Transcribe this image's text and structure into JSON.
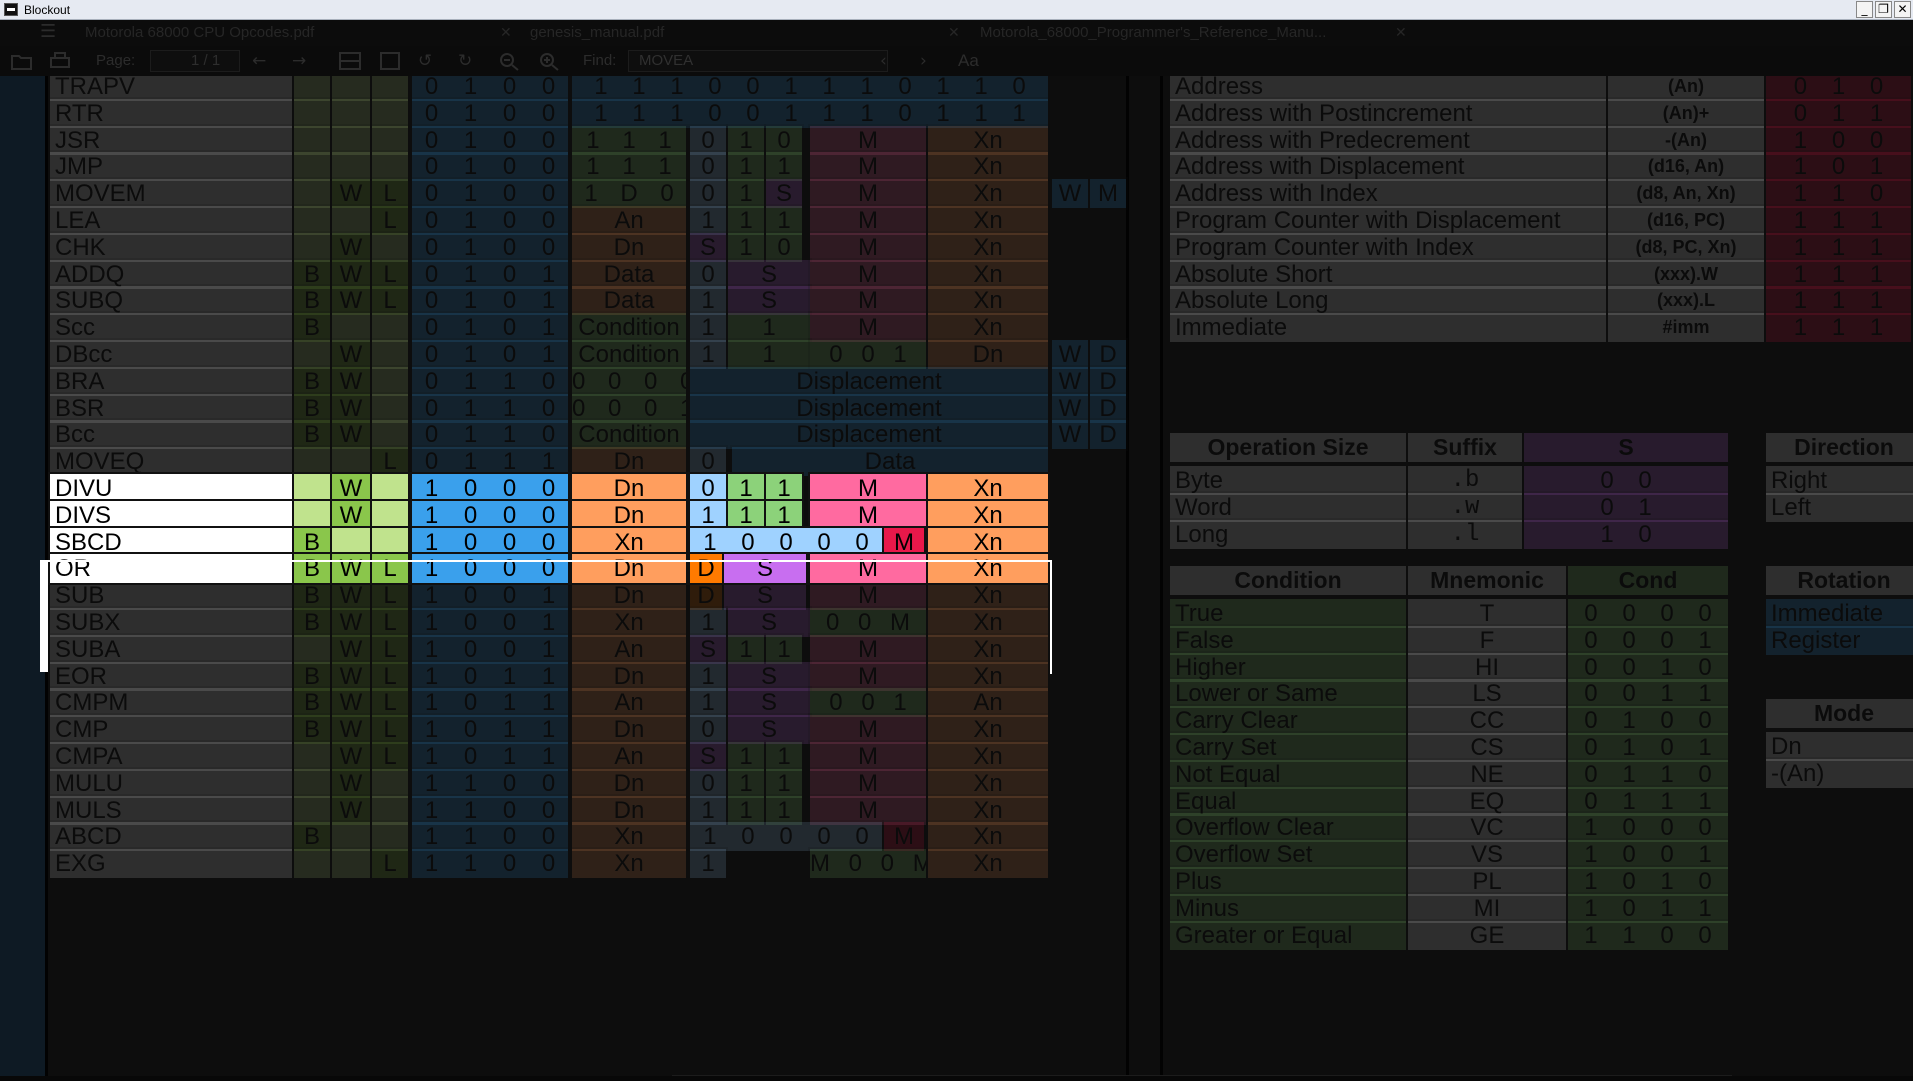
{
  "window": {
    "title": "Blockout",
    "minimize_glyph": "_",
    "restore_glyph": "❐",
    "close_glyph": "✕"
  },
  "tabs": [
    {
      "label": "Motorola 68000 CPU Opcodes.pdf",
      "close": "✕"
    },
    {
      "label": "genesis_manual.pdf",
      "close": "✕"
    },
    {
      "label": "Motorola_68000_Programmer's_Reference_Manu...",
      "close": "✕"
    }
  ],
  "toolbar": {
    "page_label": "Page:",
    "page_value": "1",
    "page_total": "/ 1",
    "find_label": "Find:",
    "find_value": "MOVEA",
    "match_case_glyph": "Aa",
    "icons": [
      "open-icon",
      "print-icon",
      "prev-page-icon",
      "next-page-icon",
      "fit-width-icon",
      "fit-page-icon",
      "rotate-left-icon",
      "rotate-right-icon",
      "zoom-out-icon",
      "zoom-in-icon",
      "find-prev-icon",
      "find-next-icon",
      "match-case-icon"
    ]
  },
  "colors": {
    "highlight_name_bg": "#ffffff",
    "size_bg": "#c0e38d",
    "size_bg_green": "#8ac64b",
    "opcode_bg": "#3aa0ec",
    "register_bg": "#ff9e5e",
    "mode_bg": "#ff6aa0",
    "bit_light_blue": "#9fd2ff",
    "bit_green": "#8cd27a",
    "size_purple": "#c86ef0",
    "m_red": "#e8184a",
    "d_orange": "#ff7a00",
    "dim_overlay": "rgba(0,0,0,0.86)"
  },
  "opcodes": [
    {
      "name": "TRAPV",
      "b": "",
      "w": "",
      "l": "",
      "op": [
        "0",
        "1",
        "0",
        "0"
      ],
      "rest": "1 1 1 0 0 1 1 1 0 1 1 0"
    },
    {
      "name": "RTR",
      "b": "",
      "w": "",
      "l": "",
      "op": [
        "0",
        "1",
        "0",
        "0"
      ],
      "rest": "1 1 1 0 0 1 1 1 0 1 1 1"
    },
    {
      "name": "JSR",
      "b": "",
      "w": "",
      "l": "",
      "op": [
        "0",
        "1",
        "0",
        "0"
      ],
      "a": "1 1 1",
      "c": "0 1 0",
      "m": "M",
      "xn": "Xn"
    },
    {
      "name": "JMP",
      "b": "",
      "w": "",
      "l": "",
      "op": [
        "0",
        "1",
        "0",
        "0"
      ],
      "a": "1 1 1",
      "c": "0 1 1",
      "m": "M",
      "xn": "Xn"
    },
    {
      "name": "MOVEM",
      "b": "",
      "w": "W",
      "l": "L",
      "op": [
        "0",
        "1",
        "0",
        "0"
      ],
      "a": "1 D 0",
      "c": "0 1 S",
      "m": "M",
      "xn": "Xn",
      "ext": [
        "W",
        "M"
      ]
    },
    {
      "name": "LEA",
      "b": "",
      "w": "",
      "l": "L",
      "op": [
        "0",
        "1",
        "0",
        "0"
      ],
      "a": "An",
      "c": "1 1 1",
      "m": "M",
      "xn": "Xn"
    },
    {
      "name": "CHK",
      "b": "",
      "w": "W",
      "l": "",
      "op": [
        "0",
        "1",
        "0",
        "0"
      ],
      "a": "Dn",
      "c": "S 1 0",
      "m": "M",
      "xn": "Xn"
    },
    {
      "name": "ADDQ",
      "b": "B",
      "w": "W",
      "l": "L",
      "op": [
        "0",
        "1",
        "0",
        "1"
      ],
      "a": "Data",
      "c": "0 S",
      "m": "M",
      "xn": "Xn"
    },
    {
      "name": "SUBQ",
      "b": "B",
      "w": "W",
      "l": "L",
      "op": [
        "0",
        "1",
        "0",
        "1"
      ],
      "a": "Data",
      "c": "1 S",
      "m": "M",
      "xn": "Xn"
    },
    {
      "name": "Scc",
      "b": "B",
      "w": "",
      "l": "",
      "op": [
        "0",
        "1",
        "0",
        "1"
      ],
      "a": "Condition",
      "c": "1 1",
      "m": "M",
      "xn": "Xn"
    },
    {
      "name": "DBcc",
      "b": "",
      "w": "W",
      "l": "",
      "op": [
        "0",
        "1",
        "0",
        "1"
      ],
      "a": "Condition",
      "c": "1 1",
      "m": "0 0 1",
      "xn": "Dn",
      "ext": [
        "W",
        "D"
      ]
    },
    {
      "name": "BRA",
      "b": "B",
      "w": "W",
      "l": "",
      "op": [
        "0",
        "1",
        "1",
        "0"
      ],
      "a": "0 0 0 0",
      "c": "Displacement",
      "ext": [
        "W",
        "D"
      ]
    },
    {
      "name": "BSR",
      "b": "B",
      "w": "W",
      "l": "",
      "op": [
        "0",
        "1",
        "1",
        "0"
      ],
      "a": "0 0 0 1",
      "c": "Displacement",
      "ext": [
        "W",
        "D"
      ]
    },
    {
      "name": "Bcc",
      "b": "B",
      "w": "W",
      "l": "",
      "op": [
        "0",
        "1",
        "1",
        "0"
      ],
      "a": "Condition",
      "c": "Displacement",
      "ext": [
        "W",
        "D"
      ]
    },
    {
      "name": "MOVEQ",
      "b": "",
      "w": "",
      "l": "L",
      "op": [
        "0",
        "1",
        "1",
        "1"
      ],
      "a": "Dn",
      "c": "0",
      "m": "Data"
    },
    {
      "name": "DIVU",
      "b": "",
      "w": "W",
      "l": "",
      "op": [
        "1",
        "0",
        "0",
        "0"
      ],
      "a": "Dn",
      "c": "0 1 1",
      "m": "M",
      "xn": "Xn",
      "hl": true
    },
    {
      "name": "DIVS",
      "b": "",
      "w": "W",
      "l": "",
      "op": [
        "1",
        "0",
        "0",
        "0"
      ],
      "a": "Dn",
      "c": "1 1 1",
      "m": "M",
      "xn": "Xn",
      "hl": true
    },
    {
      "name": "SBCD",
      "b": "B",
      "w": "",
      "l": "",
      "op": [
        "1",
        "0",
        "0",
        "0"
      ],
      "a": "Xn",
      "c": "1 0 0 0 0",
      "m": "M",
      "xn": "Xn",
      "hl": true
    },
    {
      "name": "OR",
      "b": "B",
      "w": "W",
      "l": "L",
      "op": [
        "1",
        "0",
        "0",
        "0"
      ],
      "a": "Dn",
      "c": "D S",
      "m": "M",
      "xn": "Xn",
      "hl": true
    },
    {
      "name": "SUB",
      "b": "B",
      "w": "W",
      "l": "L",
      "op": [
        "1",
        "0",
        "0",
        "1"
      ],
      "a": "Dn",
      "c": "D S",
      "m": "M",
      "xn": "Xn"
    },
    {
      "name": "SUBX",
      "b": "B",
      "w": "W",
      "l": "L",
      "op": [
        "1",
        "0",
        "0",
        "1"
      ],
      "a": "Xn",
      "c": "1 S",
      "m": "0 0 M",
      "xn": "Xn"
    },
    {
      "name": "SUBA",
      "b": "",
      "w": "W",
      "l": "L",
      "op": [
        "1",
        "0",
        "0",
        "1"
      ],
      "a": "An",
      "c": "S 1 1",
      "m": "M",
      "xn": "Xn"
    },
    {
      "name": "EOR",
      "b": "B",
      "w": "W",
      "l": "L",
      "op": [
        "1",
        "0",
        "1",
        "1"
      ],
      "a": "Dn",
      "c": "1 S",
      "m": "M",
      "xn": "Xn"
    },
    {
      "name": "CMPM",
      "b": "B",
      "w": "W",
      "l": "L",
      "op": [
        "1",
        "0",
        "1",
        "1"
      ],
      "a": "An",
      "c": "1 S",
      "m": "0 0 1",
      "xn": "An"
    },
    {
      "name": "CMP",
      "b": "B",
      "w": "W",
      "l": "L",
      "op": [
        "1",
        "0",
        "1",
        "1"
      ],
      "a": "Dn",
      "c": "0 S",
      "m": "M",
      "xn": "Xn"
    },
    {
      "name": "CMPA",
      "b": "",
      "w": "W",
      "l": "L",
      "op": [
        "1",
        "0",
        "1",
        "1"
      ],
      "a": "An",
      "c": "S 1 1",
      "m": "M",
      "xn": "Xn"
    },
    {
      "name": "MULU",
      "b": "",
      "w": "W",
      "l": "",
      "op": [
        "1",
        "1",
        "0",
        "0"
      ],
      "a": "Dn",
      "c": "0 1 1",
      "m": "M",
      "xn": "Xn"
    },
    {
      "name": "MULS",
      "b": "",
      "w": "W",
      "l": "",
      "op": [
        "1",
        "1",
        "0",
        "0"
      ],
      "a": "Dn",
      "c": "1 1 1",
      "m": "M",
      "xn": "Xn"
    },
    {
      "name": "ABCD",
      "b": "B",
      "w": "",
      "l": "",
      "op": [
        "1",
        "1",
        "0",
        "0"
      ],
      "a": "Xn",
      "c": "1 0 0 0 0",
      "m": "M",
      "xn": "Xn"
    },
    {
      "name": "EXG",
      "b": "",
      "w": "",
      "l": "L",
      "op": [
        "1",
        "1",
        "0",
        "0"
      ],
      "a": "Xn",
      "c": "1",
      "m": "M 0 0 M",
      "xn": "Xn"
    }
  ],
  "addressing_modes": [
    {
      "mode": "Address",
      "syntax": "(An)",
      "bits": "0 1 0"
    },
    {
      "mode": "Address with Postincrement",
      "syntax": "(An)+",
      "bits": "0 1 1"
    },
    {
      "mode": "Address with Predecrement",
      "syntax": "-(An)",
      "bits": "1 0 0"
    },
    {
      "mode": "Address with Displacement",
      "syntax": "(d16, An)",
      "bits": "1 0 1"
    },
    {
      "mode": "Address with Index",
      "syntax": "(d8, An, Xn)",
      "bits": "1 1 0"
    },
    {
      "mode": "Program Counter with Displacement",
      "syntax": "(d16, PC)",
      "bits": "1 1 1"
    },
    {
      "mode": "Program Counter with Index",
      "syntax": "(d8, PC, Xn)",
      "bits": "1 1 1"
    },
    {
      "mode": "Absolute Short",
      "syntax": "(xxx).W",
      "bits": "1 1 1"
    },
    {
      "mode": "Absolute Long",
      "syntax": "(xxx).L",
      "bits": "1 1 1"
    },
    {
      "mode": "Immediate",
      "syntax": "#imm",
      "bits": "1 1 1"
    }
  ],
  "operation_size": {
    "headers": [
      "Operation Size",
      "Suffix",
      "S"
    ],
    "rows": [
      {
        "size": "Byte",
        "suffix": ".b",
        "bits": "0 0"
      },
      {
        "size": "Word",
        "suffix": ".w",
        "bits": "0 1"
      },
      {
        "size": "Long",
        "suffix": ".l",
        "bits": "1 0"
      }
    ]
  },
  "direction": {
    "header": "Direction",
    "rows": [
      "Right",
      "Left"
    ]
  },
  "rotation": {
    "header": "Rotation",
    "rows": [
      "Immediate",
      "Register"
    ]
  },
  "mode_table": {
    "header": "Mode",
    "rows": [
      "Dn",
      "-(An)"
    ]
  },
  "conditions": {
    "headers": [
      "Condition",
      "Mnemonic",
      "Cond"
    ],
    "rows": [
      {
        "condition": "True",
        "mnemonic": "T",
        "bits": "0 0 0 0"
      },
      {
        "condition": "False",
        "mnemonic": "F",
        "bits": "0 0 0 1"
      },
      {
        "condition": "Higher",
        "mnemonic": "HI",
        "bits": "0 0 1 0"
      },
      {
        "condition": "Lower or Same",
        "mnemonic": "LS",
        "bits": "0 0 1 1"
      },
      {
        "condition": "Carry Clear",
        "mnemonic": "CC",
        "bits": "0 1 0 0"
      },
      {
        "condition": "Carry Set",
        "mnemonic": "CS",
        "bits": "0 1 0 1"
      },
      {
        "condition": "Not Equal",
        "mnemonic": "NE",
        "bits": "0 1 1 0"
      },
      {
        "condition": "Equal",
        "mnemonic": "EQ",
        "bits": "0 1 1 1"
      },
      {
        "condition": "Overflow Clear",
        "mnemonic": "VC",
        "bits": "1 0 0 0"
      },
      {
        "condition": "Overflow Set",
        "mnemonic": "VS",
        "bits": "1 0 0 1"
      },
      {
        "condition": "Plus",
        "mnemonic": "PL",
        "bits": "1 0 1 0"
      },
      {
        "condition": "Minus",
        "mnemonic": "MI",
        "bits": "1 0 1 1"
      },
      {
        "condition": "Greater or Equal",
        "mnemonic": "GE",
        "bits": "1 1 0 0"
      }
    ]
  }
}
